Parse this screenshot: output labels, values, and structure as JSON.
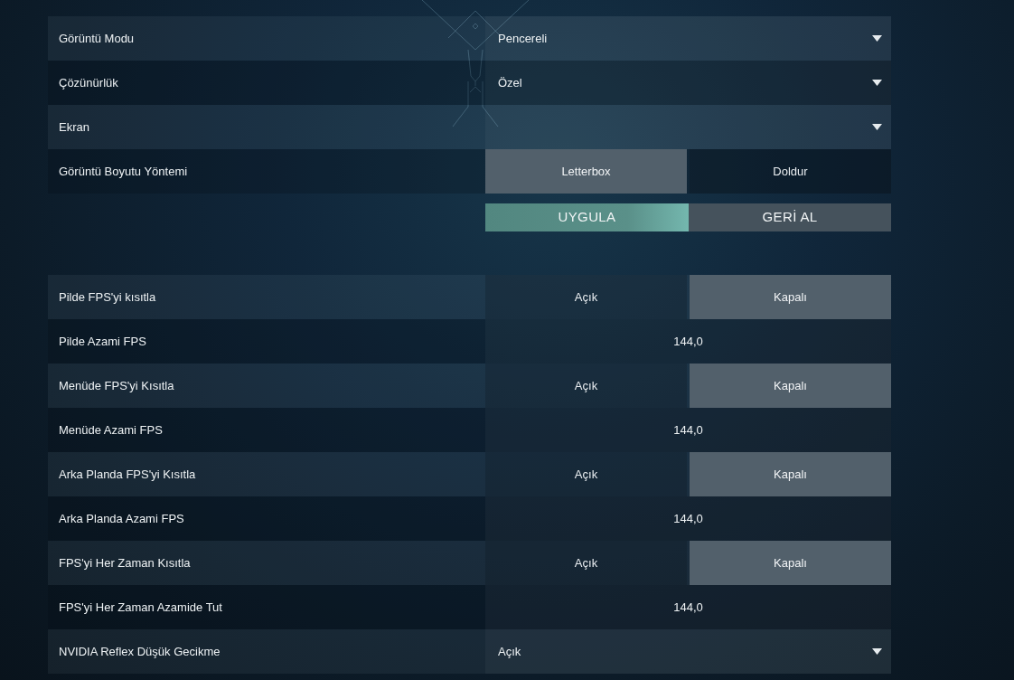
{
  "display_settings": [
    {
      "kind": "dropdown",
      "label": "Görüntü Modu",
      "value": "Pencereli"
    },
    {
      "kind": "dropdown",
      "label": "Çözünürlük",
      "value": "Özel"
    },
    {
      "kind": "dropdown",
      "label": "Ekran"
    },
    {
      "kind": "segmented",
      "label": "Görüntü Boyutu Yöntemi",
      "options": [
        {
          "label": "Letterbox",
          "selected": true
        },
        {
          "label": "Doldur",
          "selected": false
        }
      ]
    }
  ],
  "actions": [
    {
      "kind": "primary",
      "label": "UYGULA"
    },
    {
      "kind": "secondary",
      "label": "GERİ AL"
    }
  ],
  "fps_settings": [
    {
      "kind": "segmented",
      "label": "Pilde FPS'yi kısıtla",
      "options": [
        {
          "label": "Açık",
          "selected": false
        },
        {
          "label": "Kapalı",
          "selected": true
        }
      ]
    },
    {
      "kind": "number",
      "label": "Pilde Azami FPS",
      "value": "144,0"
    },
    {
      "kind": "segmented",
      "label": "Menüde FPS'yi Kısıtla",
      "options": [
        {
          "label": "Açık",
          "selected": false
        },
        {
          "label": "Kapalı",
          "selected": true
        }
      ]
    },
    {
      "kind": "number",
      "label": "Menüde Azami FPS",
      "value": "144,0"
    },
    {
      "kind": "segmented",
      "label": "Arka Planda FPS'yi Kısıtla",
      "options": [
        {
          "label": "Açık",
          "selected": false
        },
        {
          "label": "Kapalı",
          "selected": true
        }
      ]
    },
    {
      "kind": "number",
      "label": "Arka Planda Azami FPS",
      "value": "144,0"
    },
    {
      "kind": "segmented",
      "label": "FPS'yi Her Zaman Kısıtla",
      "options": [
        {
          "label": "Açık",
          "selected": false
        },
        {
          "label": "Kapalı",
          "selected": true
        }
      ]
    },
    {
      "kind": "number",
      "label": "FPS'yi Her Zaman Azamide Tut",
      "value": "144,0"
    },
    {
      "kind": "dropdown",
      "label": "NVIDIA Reflex Düşük Gecikme",
      "value": "Açık"
    }
  ]
}
